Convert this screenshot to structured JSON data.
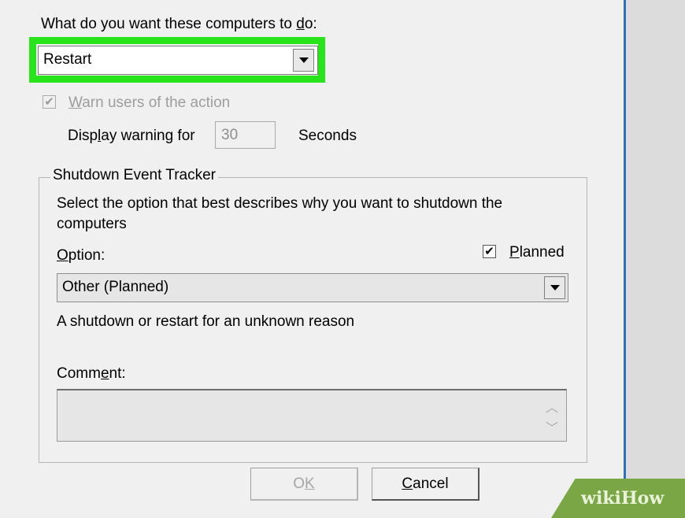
{
  "action_section": {
    "question_prefix": "What do you want these computers to ",
    "question_hotkey": "d",
    "question_suffix": "o:",
    "action_selected": "Restart"
  },
  "warn": {
    "checked": true,
    "label_hotkey": "W",
    "label_rest": "arn users of the action",
    "display_prefix": "Disp",
    "display_hotkey": "l",
    "display_suffix": "ay warning for",
    "seconds_value": "30",
    "seconds_unit": "Seconds"
  },
  "tracker": {
    "title": "Shutdown Event Tracker",
    "description_line1": "Select the option that best describes why you want to shutdown the",
    "description_line2": "computers",
    "option_hotkey": "O",
    "option_rest": "ption:",
    "planned_checked": true,
    "planned_hotkey": "P",
    "planned_rest": "lanned",
    "option_selected": "Other (Planned)",
    "option_description": "A shutdown or restart for an unknown reason",
    "comment_prefix": "Comm",
    "comment_hotkey": "e",
    "comment_suffix": "nt:",
    "comment_value": ""
  },
  "buttons": {
    "ok_prefix": "O",
    "ok_hotkey": "K",
    "cancel_hotkey": "C",
    "cancel_rest": "ancel"
  },
  "watermark": {
    "text": "wikiHow"
  },
  "colors": {
    "highlight": "#27e51a",
    "window_border": "#2f6fb8",
    "watermark_bg": "#7aa645"
  },
  "icons": {
    "dropdown": "chevron-down-icon",
    "check": "checkmark-icon",
    "scroll_up": "scroll-up-icon",
    "scroll_down": "scroll-down-icon"
  }
}
